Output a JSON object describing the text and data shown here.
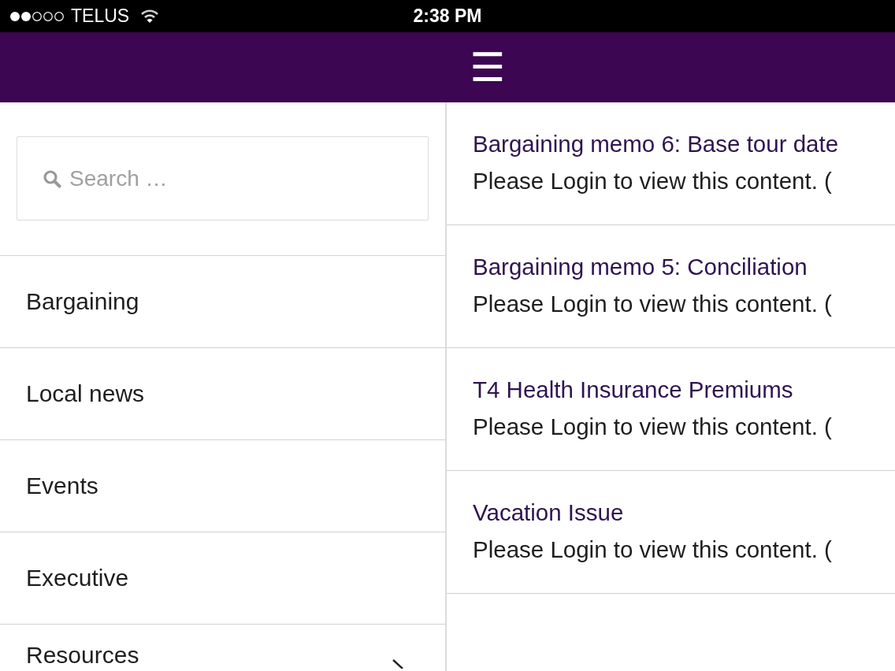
{
  "status_bar": {
    "carrier": "TELUS",
    "time": "2:38 PM"
  },
  "header": {
    "menu_label": "☰"
  },
  "sidebar": {
    "search": {
      "placeholder": "Search …"
    },
    "items": [
      {
        "label": "Bargaining",
        "has_submenu": false
      },
      {
        "label": "Local news",
        "has_submenu": false
      },
      {
        "label": "Events",
        "has_submenu": false
      },
      {
        "label": "Executive",
        "has_submenu": false
      },
      {
        "label": "Resources",
        "has_submenu": true
      }
    ]
  },
  "posts": [
    {
      "title": "Bargaining memo 6: Base tour date",
      "excerpt": "Please Login to view this content. ("
    },
    {
      "title": "Bargaining memo 5: Conciliation",
      "excerpt": "Please Login to view this content. ("
    },
    {
      "title": "T4 Health Insurance Premiums",
      "excerpt": "Please Login to view this content. ("
    },
    {
      "title": "Vacation Issue",
      "excerpt": "Please Login to view this content. ("
    }
  ]
}
